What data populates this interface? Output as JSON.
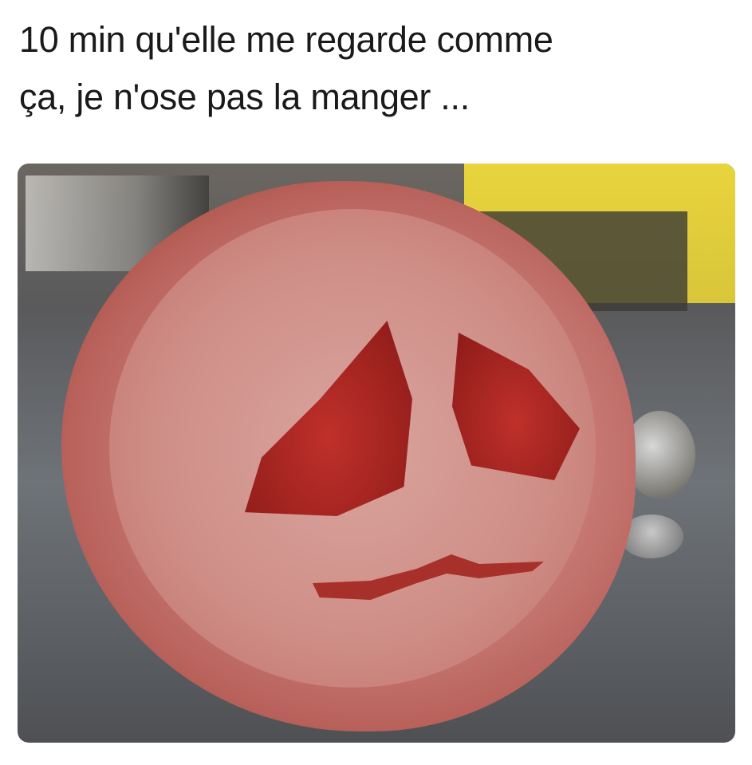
{
  "caption": {
    "line1": "10 min qu'elle me regarde comme",
    "line2": "ça, je n'ose pas la manger ..."
  },
  "photo": {
    "subject": "tomato-slice-with-sad-face"
  },
  "colors": {
    "background": "#ffffff",
    "text": "#1a1a1a",
    "tomato": "#c97c78",
    "seed_cavity": "#a82420"
  }
}
